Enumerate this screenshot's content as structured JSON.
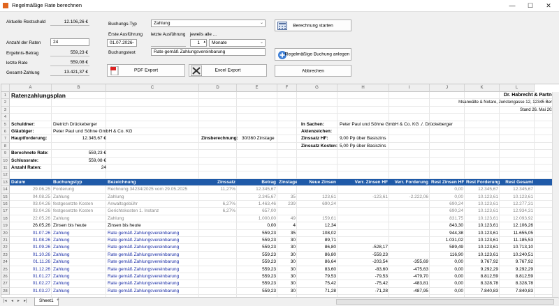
{
  "window": {
    "title": "Regelmäßige Rate berechnen",
    "minimize": "—",
    "maximize": "☐",
    "close": "✕"
  },
  "form": {
    "aktuelle_restschuld_label": "Aktuelle Restschuld",
    "aktuelle_restschuld_value": "12.106,26 €",
    "anzahl_raten_label": "Anzahl der Raten",
    "anzahl_raten_value": "24",
    "ergebnis_betrag_label": "Ergebnis-Betrag",
    "ergebnis_betrag_value": "559,23 €",
    "letzte_rate_label": "letzte Rate",
    "letzte_rate_value": "559,08 €",
    "gesamt_zahlung_label": "Gesamt-Zahlung",
    "gesamt_zahlung_value": "13.421,37 €",
    "buchungstyp_label": "Buchungs-Typ",
    "buchungstyp_value": "Zahlung",
    "erste_ausfuehrung_label": "Erste Ausführung",
    "erste_ausfuehrung_value": "01.07.2026",
    "letzte_ausfuehrung_label": "letzte Ausführung",
    "jeweils_alle_label": "jeweils alle ...",
    "intervall_value": "1",
    "einheit_value": "Monate",
    "buchungstext_label": "Buchungstext",
    "buchungstext_value": "Rate gemäß Zahlungsvereinbarung",
    "pdf_export": "PDF Export",
    "excel_export": "Excel Export",
    "berechnung_starten": "Berechnung starten",
    "regelmaessige_buchung": "Regelmäßige Buchung anlegen",
    "abbrechen": "Abbrechen"
  },
  "sheet": {
    "columns": [
      "A",
      "B",
      "C",
      "D",
      "E",
      "F",
      "G",
      "H",
      "I",
      "J",
      "K",
      "L"
    ],
    "rownums": [
      "1",
      "2",
      "3",
      "4",
      "5",
      "6",
      "7",
      "8",
      "9",
      "10",
      "11",
      "12",
      "13",
      "14",
      "15",
      "16",
      "17",
      "18",
      "19",
      "20",
      "21",
      "22",
      "23",
      "24",
      "25",
      "26",
      "27",
      "28"
    ],
    "title": "Ratenzahlungsplan",
    "firm": "Dr. Habrecht & Partner",
    "firm_sub": "htsanwälte & Notare, Juristengasse 12, 12345 Berlin",
    "stand": "Stand 26. Mai 2026",
    "schuldner_label": "Schuldner:",
    "schuldner": "Dietrich  Drückeberger",
    "glaeubiger_label": "Gläubiger:",
    "glaeubiger": "Peter Paul und Söhne GmbH & Co. KG",
    "hauptforderung_label": "Hauptforderung:",
    "hauptforderung": "12.345,67 €",
    "zinsberechnung_label": "Zinsberechnung:",
    "zinsberechnung": "30/360 Zinstage",
    "in_sachen_label": "In Sachen:",
    "in_sachen": "Peter Paul und Söhne GmbH & Co. KG ./. Drückeberger",
    "aktenzeichen_label": "Aktenzeichen:",
    "zinssatz_hf_label": "Zinssatz HF:",
    "zinssatz_hf": "9,00 Pp über Basiszins",
    "zinssatz_kosten_label": "Zinssatz Kosten:",
    "zinssatz_kosten": "5,00 Pp über Basiszins",
    "berechnete_rate_label": "Berechnete Rate:",
    "berechnete_rate": "559,23 €",
    "schlussrate_label": "Schlussrate:",
    "schlussrate": "559,08 €",
    "anzahl_raten_label": "Anzahl Raten:",
    "anzahl_raten": "24",
    "headers": [
      "Datum",
      "Buchungstyp",
      "Bezeichnung",
      "Zinssatz",
      "Betrag",
      "Zinstage",
      "Neue Zinsen",
      "Verr. Zinsen HF",
      "Verr. Forderung",
      "Rest Zinsen HF",
      "Rest Forderung",
      "Rest Gesamt"
    ],
    "rows": [
      {
        "style": "grey",
        "cells": [
          "29.06.25",
          "Forderung",
          "Rechnung 34234/2025 vom 29.05.2025",
          "11,27%",
          "12.345,67",
          "",
          "",
          "",
          "",
          "0,00",
          "12.345,67",
          "12.345,67"
        ]
      },
      {
        "style": "grey",
        "cells": [
          "04.08.25",
          "Zahlung",
          "Zahlung",
          "",
          "2.345,67",
          "35",
          "123,61",
          "-123,61",
          "-2.222,06",
          "0,00",
          "10.123,61",
          "10.123,61"
        ]
      },
      {
        "style": "grey",
        "cells": [
          "03.04.26",
          "festgesetzte Kosten",
          "Anwaltsgebühr",
          "6,27%",
          "1.463,46",
          "239",
          "690,24",
          "",
          "",
          "690,24",
          "10.123,61",
          "12.277,31"
        ]
      },
      {
        "style": "grey",
        "cells": [
          "03.04.26",
          "festgesetzte Kosten",
          "Gerichtskosten 1. Instanz",
          "6,27%",
          "657,00",
          "",
          "",
          "",
          "",
          "690,24",
          "10.123,61",
          "12.934,31"
        ]
      },
      {
        "style": "grey",
        "cells": [
          "22.05.26",
          "Zahlung",
          "Zahlung",
          "",
          "1.000,00",
          "49",
          "159,61",
          "",
          "",
          "831,75",
          "10.123,61",
          "12.093,92"
        ]
      },
      {
        "style": "black",
        "cells": [
          "26.05.26",
          "Zinsen bis heute",
          "Zinsen bis heute",
          "",
          "0,00",
          "4",
          "12,34",
          "",
          "",
          "843,30",
          "10.123,61",
          "12.106,26"
        ]
      },
      {
        "style": "blue",
        "cells": [
          "01.07.26",
          "Zahlung",
          "Rate gemäß Zahlungsvereinbarung",
          "",
          "559,23",
          "35",
          "108,02",
          "",
          "",
          "944,38",
          "10.123,61",
          "11.655,05"
        ]
      },
      {
        "style": "blue",
        "cells": [
          "01.08.26",
          "Zahlung",
          "Rate gemäß Zahlungsvereinbarung",
          "",
          "559,23",
          "30",
          "89,71",
          "",
          "",
          "1.031,02",
          "10.123,61",
          "11.185,53"
        ]
      },
      {
        "style": "blue",
        "cells": [
          "01.09.26",
          "Zahlung",
          "Rate gemäß Zahlungsvereinbarung",
          "",
          "559,23",
          "30",
          "86,80",
          "-528,17",
          "",
          "589,49",
          "10.123,61",
          "10.713,10"
        ]
      },
      {
        "style": "blue",
        "cells": [
          "01.10.26",
          "Zahlung",
          "Rate gemäß Zahlungsvereinbarung",
          "",
          "559,23",
          "30",
          "86,80",
          "-559,23",
          "",
          "116,90",
          "10.123,61",
          "10.240,51"
        ]
      },
      {
        "style": "blue",
        "cells": [
          "01.11.26",
          "Zahlung",
          "Rate gemäß Zahlungsvereinbarung",
          "",
          "559,23",
          "30",
          "86,64",
          "-203,54",
          "-355,69",
          "0,00",
          "9.767,92",
          "9.767,92"
        ]
      },
      {
        "style": "blue",
        "cells": [
          "01.12.26",
          "Zahlung",
          "Rate gemäß Zahlungsvereinbarung",
          "",
          "559,23",
          "30",
          "83,60",
          "-83,60",
          "-475,63",
          "0,00",
          "9.292,29",
          "9.292,29"
        ]
      },
      {
        "style": "blue",
        "cells": [
          "01.01.27",
          "Zahlung",
          "Rate gemäß Zahlungsvereinbarung",
          "",
          "559,23",
          "30",
          "79,53",
          "-79,53",
          "-479,70",
          "0,00",
          "8.812,59",
          "8.812,59"
        ]
      },
      {
        "style": "blue",
        "cells": [
          "01.02.27",
          "Zahlung",
          "Rate gemäß Zahlungsvereinbarung",
          "",
          "559,23",
          "30",
          "75,42",
          "-75,42",
          "-483,81",
          "0,00",
          "8.328,78",
          "8.328,78"
        ]
      },
      {
        "style": "blue",
        "cells": [
          "01.03.27",
          "Zahlung",
          "Rate gemäß Zahlungsvereinbarung",
          "",
          "559,23",
          "30",
          "71,28",
          "-71,28",
          "-487,95",
          "0,00",
          "7.840,83",
          "7.840,83"
        ]
      }
    ],
    "tab_name": "Sheet1",
    "add_tab": "+"
  }
}
